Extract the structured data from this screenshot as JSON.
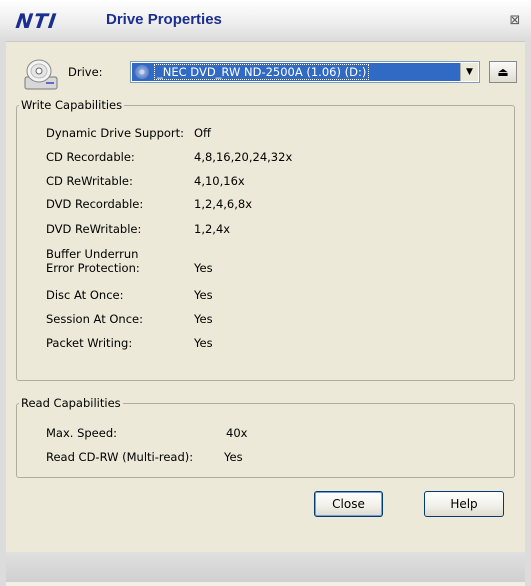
{
  "window": {
    "logo": "NTI",
    "title": "Drive Properties",
    "close_symbol": "⊠"
  },
  "drive": {
    "label": "Drive:",
    "selected": "_NEC DVD_RW ND-2500A (1.06) (D:)",
    "eject_symbol": "⏏"
  },
  "write_capabilities": {
    "title": "Write Capabilities",
    "rows": [
      {
        "label": "Dynamic Drive Support:",
        "value": "Off"
      },
      {
        "label": "CD Recordable:",
        "value": "4,8,16,20,24,32x"
      },
      {
        "label": "CD ReWritable:",
        "value": "4,10,16x"
      },
      {
        "label": "DVD Recordable:",
        "value": "1,2,4,6,8x"
      },
      {
        "label": "DVD ReWritable:",
        "value": "1,2,4x"
      },
      {
        "label": "Buffer Underrun",
        "label2": "Error Protection:",
        "value": "Yes"
      },
      {
        "label": "Disc At Once:",
        "value": "Yes"
      },
      {
        "label": "Session At Once:",
        "value": "Yes"
      },
      {
        "label": "Packet Writing:",
        "value": "Yes"
      }
    ]
  },
  "read_capabilities": {
    "title": "Read Capabilities",
    "rows": [
      {
        "label": "Max. Speed:",
        "value": "40x"
      },
      {
        "label": "Read CD-RW (Multi-read):",
        "value": "Yes"
      }
    ]
  },
  "buttons": {
    "close": "Close",
    "help": "Help"
  }
}
